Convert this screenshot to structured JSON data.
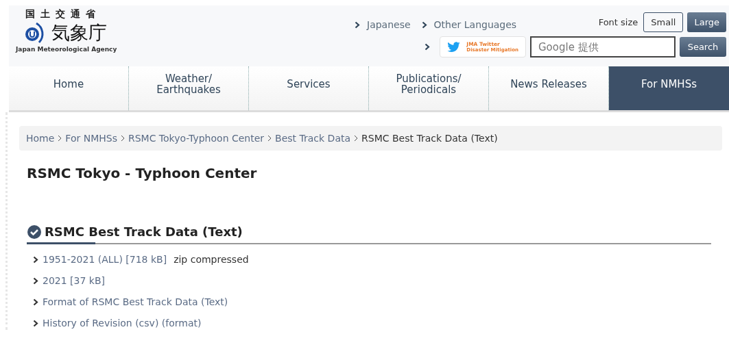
{
  "header": {
    "ministry": "国土交通省",
    "agency": "気象庁",
    "agency_en": "Japan Meteorological Agency",
    "language_links": [
      "Japanese",
      "Other Languages"
    ],
    "twitter": {
      "line1": "JMA Twitter",
      "line2": "Disaster Mitigation"
    },
    "font_size": {
      "label": "Font size",
      "options": [
        {
          "label": "Small",
          "selected": true
        },
        {
          "label": "Large",
          "selected": false
        }
      ]
    },
    "search": {
      "placeholder": "Google 提供",
      "button": "Search"
    }
  },
  "nav": [
    {
      "label": "Home",
      "selected": false
    },
    {
      "label": "Weather/\nEarthquakes",
      "selected": false
    },
    {
      "label": "Services",
      "selected": false
    },
    {
      "label": "Publications/\nPeriodicals",
      "selected": false
    },
    {
      "label": "News Releases",
      "selected": false
    },
    {
      "label": "For NMHSs",
      "selected": true
    }
  ],
  "breadcrumb": [
    {
      "label": "Home",
      "link": true
    },
    {
      "label": "For NMHSs",
      "link": true
    },
    {
      "label": "RSMC Tokyo-Typhoon Center",
      "link": true
    },
    {
      "label": "Best Track Data",
      "link": true
    },
    {
      "label": "RSMC Best Track Data (Text)",
      "link": false
    }
  ],
  "page_title": "RSMC Tokyo - Typhoon Center",
  "section": {
    "title": "RSMC Best Track Data (Text)",
    "items": [
      {
        "link": "1951-2021 (ALL) [718 kB]",
        "note": "zip compressed"
      },
      {
        "link": "2021 [37 kB]"
      },
      {
        "link": "Format of RSMC Best Track Data (Text)"
      },
      {
        "link": "History of Revision (csv) (format)"
      }
    ]
  }
}
